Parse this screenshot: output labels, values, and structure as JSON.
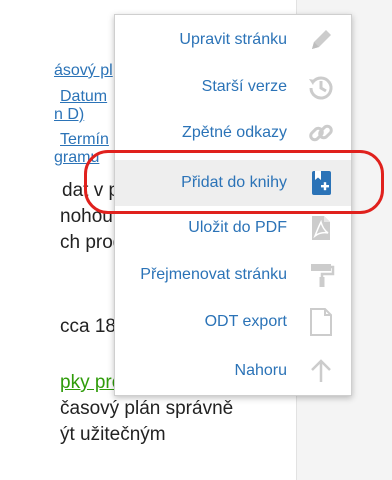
{
  "page_fragments": {
    "link1": "ásový pl",
    "link2a": "Datum",
    "link2b": "n D)",
    "link3a": "Termín",
    "link3b": "gramu",
    "text1": "dat v p",
    "text2": "nohou",
    "text3": "ch prog",
    "text4": "cca 18",
    "green_link": "pky pro",
    "text5": "časový plán správně",
    "text6": "ýt užitečným"
  },
  "menu": {
    "items": [
      {
        "label": "Upravit stránku",
        "icon": "pencil-icon"
      },
      {
        "label": "Starší verze",
        "icon": "history-icon"
      },
      {
        "label": "Zpětné odkazy",
        "icon": "link-icon"
      },
      {
        "label": "Přidat do knihy",
        "icon": "book-add-icon"
      },
      {
        "label": "Uložit do PDF",
        "icon": "pdf-icon"
      },
      {
        "label": "Přejmenovat stránku",
        "icon": "paint-roller-icon"
      },
      {
        "label": "ODT export",
        "icon": "document-icon"
      },
      {
        "label": "Nahoru",
        "icon": "arrow-up-icon"
      }
    ],
    "highlighted_index": 3
  },
  "colors": {
    "link": "#2b73b7",
    "highlight_ring": "#e0211d",
    "icon_gray": "#cccccc",
    "icon_active": "#2b73b7"
  }
}
